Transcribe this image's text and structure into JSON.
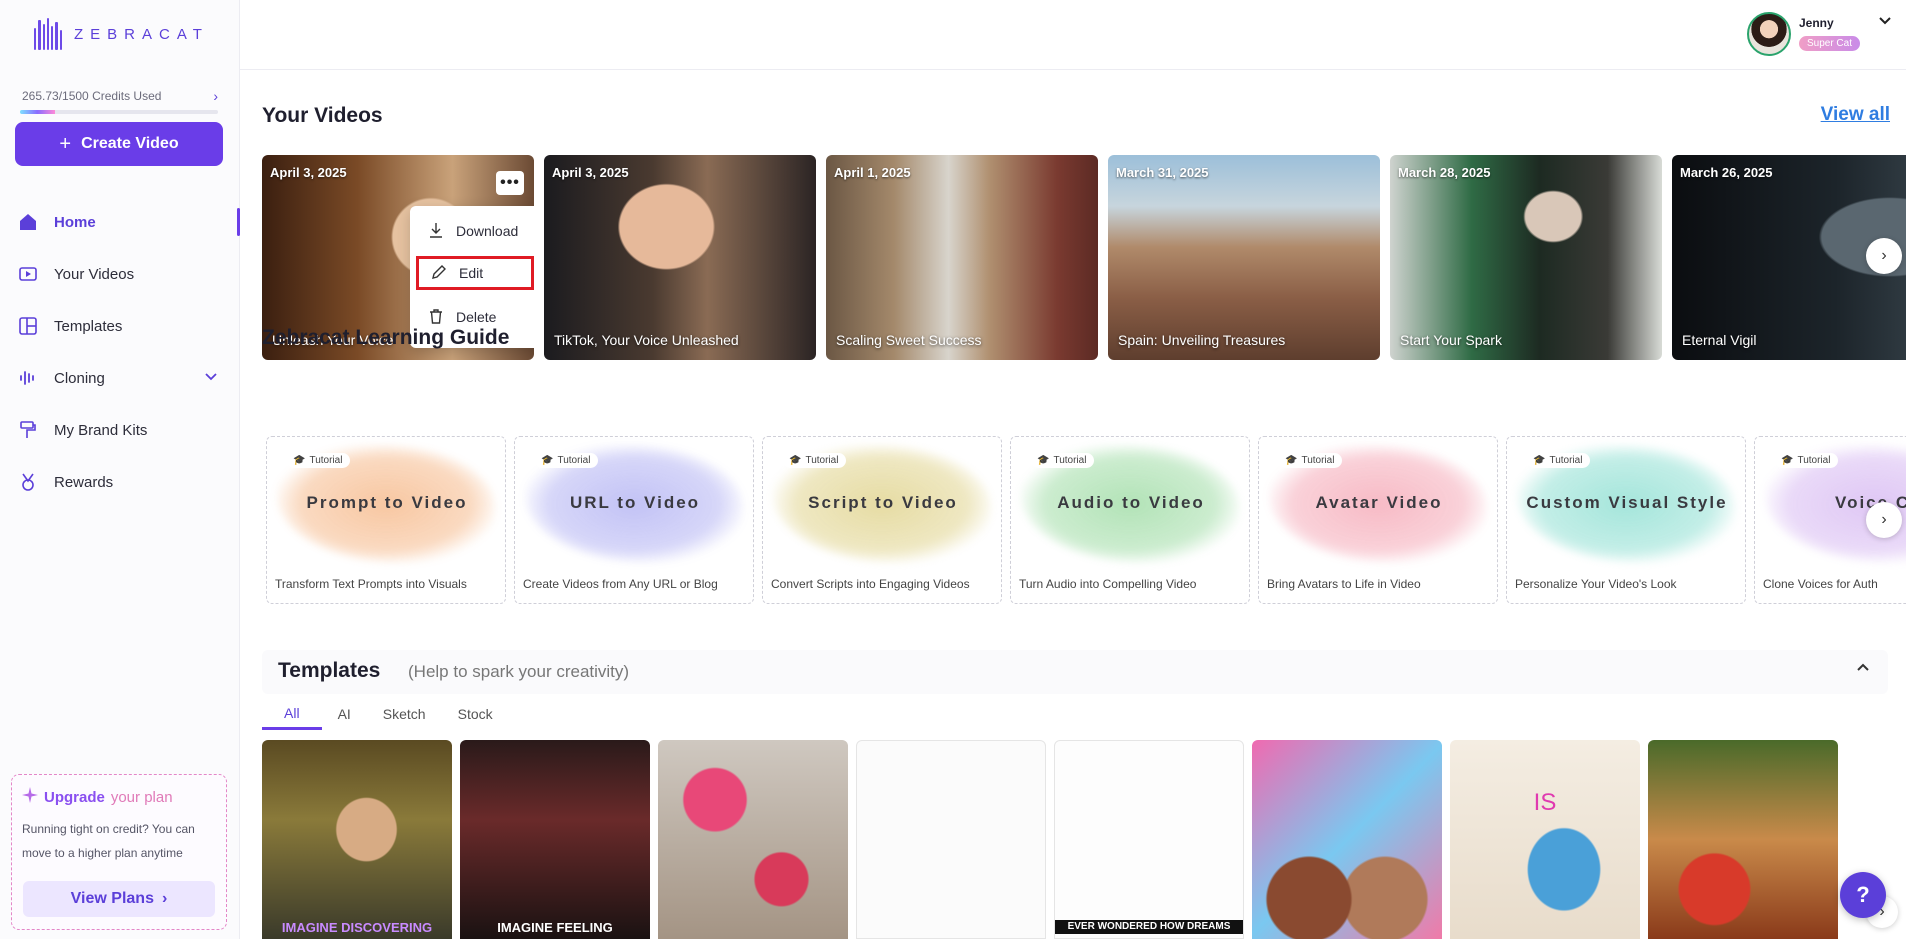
{
  "brand": {
    "name": "ZEBRACAT"
  },
  "credits": {
    "text": "265.73/1500 Credits Used",
    "used": 265.73,
    "total": 1500
  },
  "sidebar": {
    "create_label": "Create Video",
    "items": [
      {
        "label": "Home",
        "icon": "home-icon",
        "active": true
      },
      {
        "label": "Your Videos",
        "icon": "video-icon"
      },
      {
        "label": "Templates",
        "icon": "layout-icon"
      },
      {
        "label": "Cloning",
        "icon": "waveform-icon"
      },
      {
        "label": "My Brand Kits",
        "icon": "paint-roller-icon"
      },
      {
        "label": "Rewards",
        "icon": "medal-icon"
      }
    ]
  },
  "upgrade": {
    "title_main": "Upgrade",
    "title_accent": "your plan",
    "text": "Running tight on credit? You can move to a higher plan anytime",
    "button": "View Plans"
  },
  "user": {
    "name": "Jenny",
    "badge": "Super Cat"
  },
  "your_videos": {
    "title": "Your Videos",
    "view_all": "View all",
    "videos": [
      {
        "date": "April 3, 2025",
        "title": "Unleash Your Voice"
      },
      {
        "date": "April 3, 2025",
        "title": "TikTok, Your Voice Unleashed"
      },
      {
        "date": "April 1, 2025",
        "title": "Scaling Sweet Success"
      },
      {
        "date": "March 31, 2025",
        "title": "Spain: Unveiling Treasures"
      },
      {
        "date": "March 28, 2025",
        "title": "Start Your Spark"
      },
      {
        "date": "March 26, 2025",
        "title": "Eternal Vigil"
      }
    ],
    "menu": {
      "download": "Download",
      "edit": "Edit",
      "delete": "Delete"
    }
  },
  "learning": {
    "title": "Zebracat Learning Guide",
    "tag": "Tutorial",
    "cards": [
      {
        "name": "Prompt to Video",
        "desc": "Transform Text Prompts into Visuals",
        "color": "#f6b98a"
      },
      {
        "name": "URL to Video",
        "desc": "Create Videos from Any URL or Blog",
        "color": "#b3b3f3"
      },
      {
        "name": "Script to Video",
        "desc": "Convert Scripts into Engaging Videos",
        "color": "#e0d38c"
      },
      {
        "name": "Audio to Video",
        "desc": "Turn Audio into Compelling Video",
        "color": "#9fdca5"
      },
      {
        "name": "Avatar Video",
        "desc": "Bring Avatars to Life in Video",
        "color": "#f5a9b7"
      },
      {
        "name": "Custom Visual Style",
        "desc": "Personalize Your Video's Look",
        "color": "#8edfd2"
      },
      {
        "name": "Voice C",
        "desc": "Clone Voices for Auth",
        "color": "#d7b9f2"
      }
    ]
  },
  "templates": {
    "title": "Templates",
    "subtitle": "(Help to spark your creativity)",
    "tabs": [
      "All",
      "AI",
      "Sketch",
      "Stock"
    ],
    "captions": [
      "IMAGINE DISCOVERING",
      "IMAGINE FEELING",
      "",
      "",
      "EVER WONDERED HOW DREAMS",
      "",
      "IS",
      ""
    ]
  }
}
